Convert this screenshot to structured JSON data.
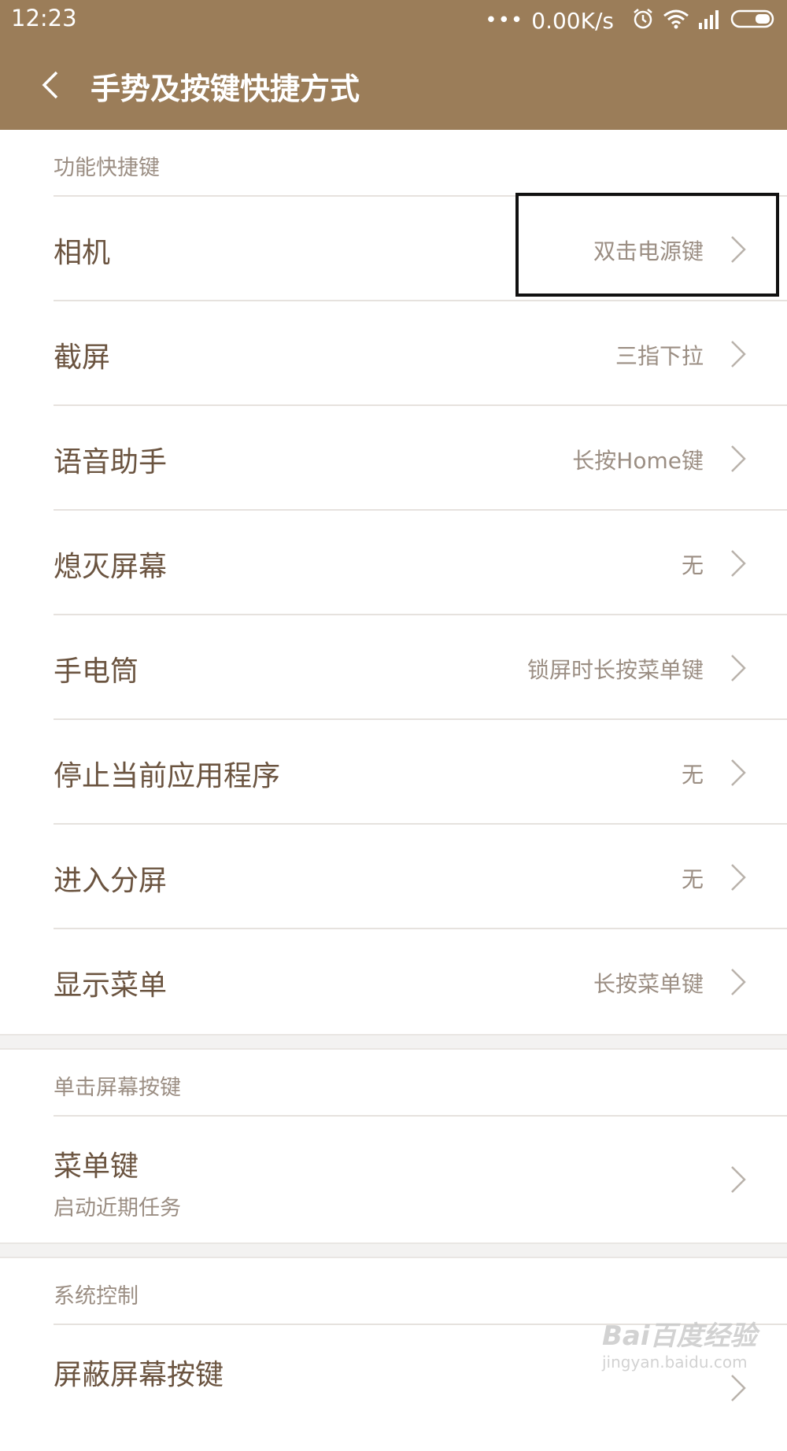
{
  "status_bar": {
    "time": "12:23",
    "dots": "•••",
    "speed": "0.00K/s",
    "icons": [
      "alarm-icon",
      "wifi-icon",
      "signal-icon",
      "battery-icon"
    ]
  },
  "header": {
    "back_icon": "chevron-left-icon",
    "title": "手势及按键快捷方式"
  },
  "sections": [
    {
      "header": "功能快捷键",
      "rows": [
        {
          "title": "相机",
          "value": "双击电源键"
        },
        {
          "title": "截屏",
          "value": "三指下拉"
        },
        {
          "title": "语音助手",
          "value": "长按Home键"
        },
        {
          "title": "熄灭屏幕",
          "value": "无"
        },
        {
          "title": "手电筒",
          "value": "锁屏时长按菜单键"
        },
        {
          "title": "停止当前应用程序",
          "value": "无"
        },
        {
          "title": "进入分屏",
          "value": "无"
        },
        {
          "title": "显示菜单",
          "value": "长按菜单键"
        }
      ]
    },
    {
      "header": "单击屏幕按键",
      "rows": [
        {
          "title": "菜单键",
          "subtitle": "启动近期任务"
        }
      ]
    },
    {
      "header": "系统控制",
      "rows": [
        {
          "title": "屏蔽屏幕按键",
          "subtitle": ""
        }
      ]
    }
  ],
  "watermark": {
    "main": "Bai百度经验",
    "sub": "jingyan.baidu.com"
  },
  "colors": {
    "header_bg": "#9b7d59",
    "title_text": "#6b5440",
    "secondary_text": "#9b8e83",
    "divider": "#e6e2de"
  }
}
